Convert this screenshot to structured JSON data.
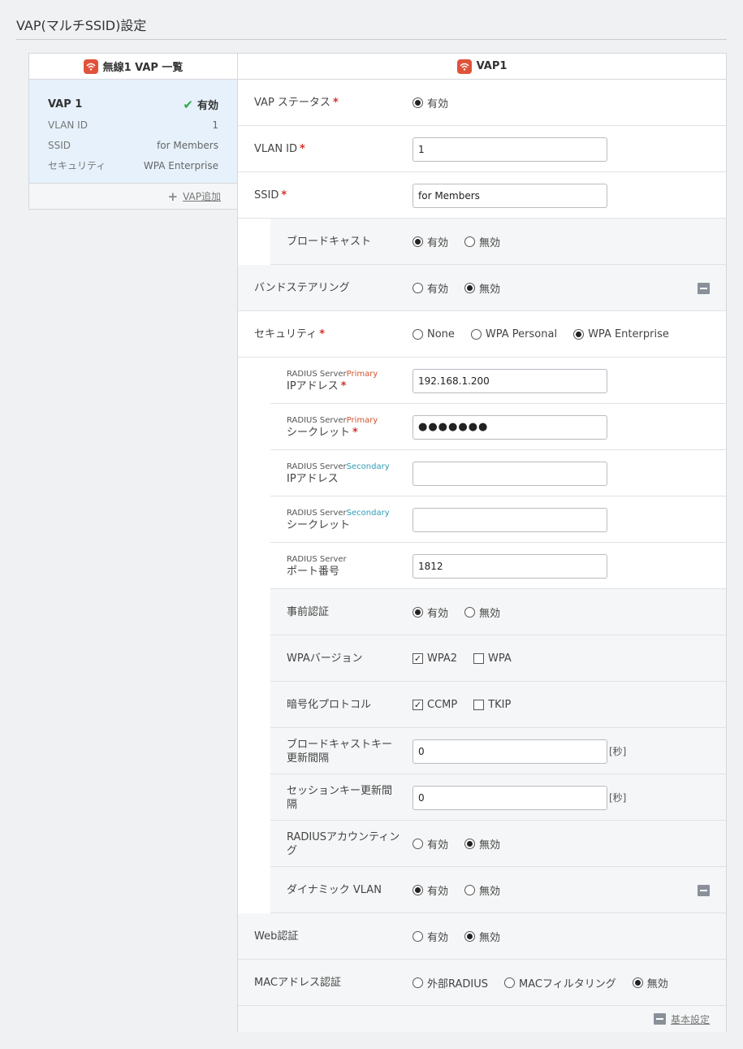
{
  "page_title": "VAP(マルチSSID)設定",
  "left": {
    "header": "無線1 VAP 一覧",
    "card": {
      "name": "VAP 1",
      "status": "有効",
      "rows": [
        {
          "label": "VLAN ID",
          "value": "1"
        },
        {
          "label": "SSID",
          "value": "for Members"
        },
        {
          "label": "セキュリティ",
          "value": "WPA Enterprise"
        }
      ]
    },
    "add_label": "VAP追加"
  },
  "right": {
    "header": "VAP1",
    "vap_status": {
      "label": "VAP ステータス",
      "opt1": "有効"
    },
    "vlan_id": {
      "label": "VLAN ID",
      "value": "1"
    },
    "ssid": {
      "label": "SSID",
      "value": "for Members"
    },
    "broadcast": {
      "label": "ブロードキャスト",
      "opt1": "有効",
      "opt2": "無効"
    },
    "band_steering": {
      "label": "バンドステアリング",
      "opt1": "有効",
      "opt2": "無効"
    },
    "security": {
      "label": "セキュリティ",
      "opt1": "None",
      "opt2": "WPA Personal",
      "opt3": "WPA Enterprise"
    },
    "radius_primary_ip": {
      "prefix": "RADIUS Server",
      "tag": "Primary",
      "label": "IPアドレス",
      "value": "192.168.1.200"
    },
    "radius_primary_secret": {
      "prefix": "RADIUS Server",
      "tag": "Primary",
      "label": "シークレット",
      "value": "●●●●●●●"
    },
    "radius_secondary_ip": {
      "prefix": "RADIUS Server",
      "tag": "Secondary",
      "label": "IPアドレス",
      "value": ""
    },
    "radius_secondary_secret": {
      "prefix": "RADIUS Server",
      "tag": "Secondary",
      "label": "シークレット",
      "value": ""
    },
    "radius_port": {
      "prefix": "RADIUS Server",
      "label": "ポート番号",
      "value": "1812"
    },
    "preauth": {
      "label": "事前認証",
      "opt1": "有効",
      "opt2": "無効"
    },
    "wpa_version": {
      "label": "WPAバージョン",
      "opt1": "WPA2",
      "opt2": "WPA"
    },
    "encryption": {
      "label": "暗号化プロトコル",
      "opt1": "CCMP",
      "opt2": "TKIP"
    },
    "broadcast_key": {
      "label1": "ブロードキャストキー",
      "label2": "更新間隔",
      "value": "0",
      "unit": "[秒]"
    },
    "session_key": {
      "label1": "セッションキー更新間",
      "label2": "隔",
      "value": "0",
      "unit": "[秒]"
    },
    "radius_accounting": {
      "label1": "RADIUSアカウンティン",
      "label2": "グ",
      "opt1": "有効",
      "opt2": "無効"
    },
    "dynamic_vlan": {
      "label": "ダイナミック VLAN",
      "opt1": "有効",
      "opt2": "無効"
    },
    "web_auth": {
      "label": "Web認証",
      "opt1": "有効",
      "opt2": "無効"
    },
    "mac_auth": {
      "label": "MACアドレス認証",
      "opt1": "外部RADIUS",
      "opt2": "MACフィルタリング",
      "opt3": "無効"
    },
    "footer_label": "基本設定"
  },
  "colors": {
    "accent": "#e0533a",
    "required": "#d2322d",
    "primary_tag": "#d2542f",
    "secondary_tag": "#2f9db6",
    "selected_bg": "#e6f1fb",
    "check": "#2fa84f"
  }
}
